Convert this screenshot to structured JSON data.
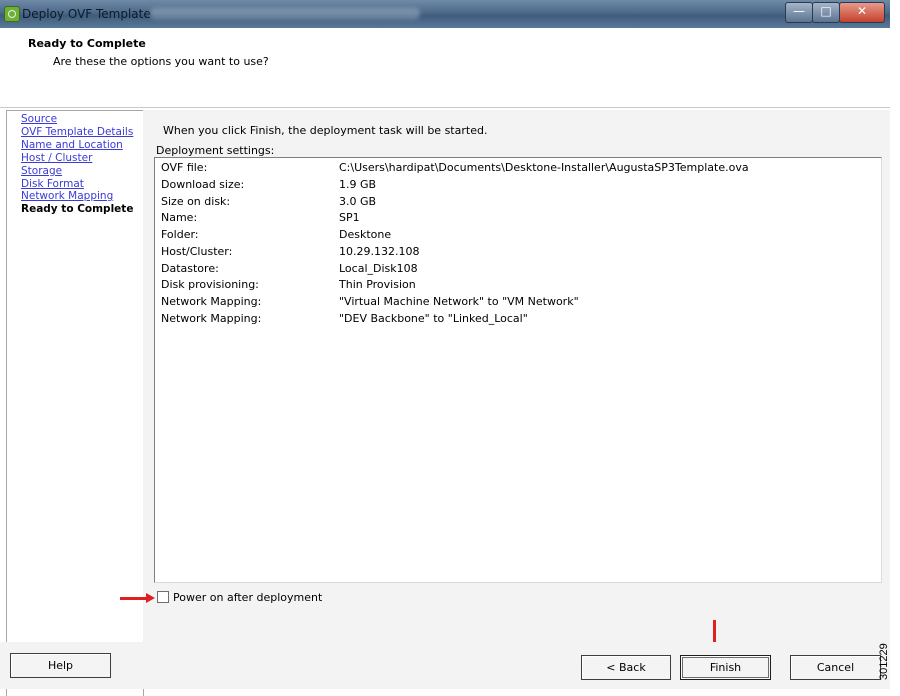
{
  "window": {
    "title": "Deploy OVF Template"
  },
  "header": {
    "title": "Ready to Complete",
    "subtitle": "Are these the options you want to use?"
  },
  "nav": {
    "items": [
      {
        "label": "Source"
      },
      {
        "label": "OVF Template Details"
      },
      {
        "label": "Name and Location"
      },
      {
        "label": "Host / Cluster"
      },
      {
        "label": "Storage"
      },
      {
        "label": "Disk Format"
      },
      {
        "label": "Network Mapping"
      },
      {
        "label": "Ready to Complete",
        "current": true
      }
    ]
  },
  "main": {
    "intro": "When you click Finish, the deployment task will be started.",
    "settings_label": "Deployment settings:",
    "settings": [
      {
        "key": "OVF file:",
        "value": "C:\\Users\\hardipat\\Documents\\Desktone-Installer\\AugustaSP3Template.ova"
      },
      {
        "key": "Download size:",
        "value": "1.9 GB"
      },
      {
        "key": "Size on disk:",
        "value": "3.0 GB"
      },
      {
        "key": "Name:",
        "value": "SP1"
      },
      {
        "key": "Folder:",
        "value": "Desktone"
      },
      {
        "key": "Host/Cluster:",
        "value": "10.29.132.108"
      },
      {
        "key": "Datastore:",
        "value": "Local_Disk108"
      },
      {
        "key": "Disk provisioning:",
        "value": "Thin Provision"
      },
      {
        "key": "Network Mapping:",
        "value": "\"Virtual Machine Network\" to \"VM Network\""
      },
      {
        "key": "Network Mapping:",
        "value": "\"DEV Backbone\" to \"Linked_Local\""
      }
    ],
    "power_on_label": "Power on after deployment",
    "power_on_checked": false
  },
  "buttons": {
    "help": "Help",
    "back": "< Back",
    "finish": "Finish",
    "cancel": "Cancel"
  },
  "figure_id": "301229",
  "colors": {
    "annotation_arrow": "#e02020",
    "link": "#3a3ad8"
  }
}
